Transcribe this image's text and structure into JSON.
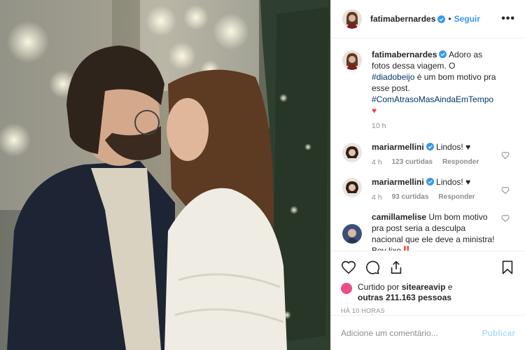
{
  "post": {
    "author": "fatimabernardes",
    "follow_label": "Seguir",
    "more_label": "•••",
    "separator": "•"
  },
  "caption": {
    "user": "fatimabernardes",
    "text_1": " Adoro as fotos dessa viagem. O ",
    "hashtag_1": "#diadobeijo",
    "text_2": " é um bom motivo pra esse post. ",
    "hashtag_2": "#ComAtrasoMasAindaEmTempo",
    "heart": "♥",
    "time": "10 h"
  },
  "comments": [
    {
      "user": "mariarmellini",
      "verified": true,
      "text": " Lindos! ♥",
      "time": "4 h",
      "likes": "123 curtidas",
      "reply": "Responder"
    },
    {
      "user": "mariarmellini",
      "verified": true,
      "text": " Lindos! ♥",
      "time": "4 h",
      "likes": "93 curtidas",
      "reply": "Responder"
    },
    {
      "user": "camillamelise",
      "verified": false,
      "text": " Um bom motivo pra post seria a desculpa nacional que ele deve a ministra! Boy lixo‼️",
      "time": "",
      "likes": "",
      "reply": ""
    }
  ],
  "likes": {
    "prefix": "Curtido por ",
    "user": "siteareavip",
    "middle": " e",
    "others": "outras 211.163 pessoas"
  },
  "posted_time": "HÁ 10 HORAS",
  "add_comment": {
    "placeholder": "Adicione um comentário...",
    "publish_label": "Publicar"
  },
  "colors": {
    "link": "#3897f0",
    "hashtag": "#003569",
    "verified": "#3897f0",
    "heart": "#ed4956",
    "muted": "#8e8e8e"
  },
  "icons": [
    "heart-icon",
    "comment-icon",
    "share-icon",
    "bookmark-icon",
    "verified-icon",
    "more-icon"
  ]
}
